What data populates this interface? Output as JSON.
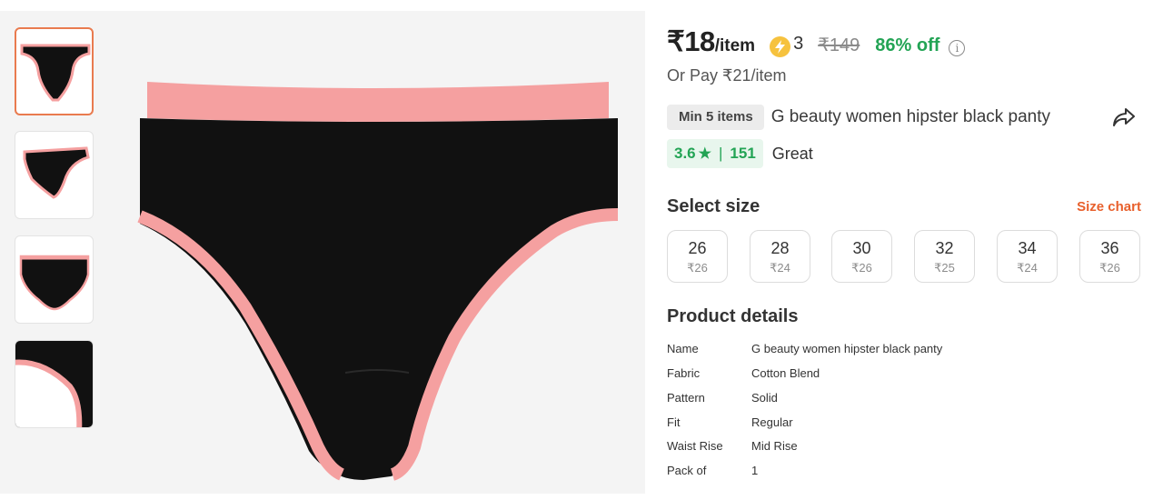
{
  "thumbnails": [
    {
      "name": "thumbnail-front",
      "active": true
    },
    {
      "name": "thumbnail-side",
      "active": false
    },
    {
      "name": "thumbnail-back",
      "active": false
    },
    {
      "name": "thumbnail-closeup",
      "active": false
    }
  ],
  "price": {
    "current": "₹18",
    "unit": "/item",
    "coins": "3",
    "mrp": "₹149",
    "discount": "86% off",
    "or_pay": "Or Pay ₹21/item"
  },
  "product": {
    "min_badge": "Min 5 items",
    "title": "G beauty women hipster black panty"
  },
  "rating": {
    "score": "3.6",
    "star": "★",
    "divider": "|",
    "count": "151",
    "label": "Great"
  },
  "size_section": {
    "title": "Select size",
    "chart_link": "Size chart",
    "sizes": [
      {
        "size": "26",
        "price": "₹26"
      },
      {
        "size": "28",
        "price": "₹24"
      },
      {
        "size": "30",
        "price": "₹26"
      },
      {
        "size": "32",
        "price": "₹25"
      },
      {
        "size": "34",
        "price": "₹24"
      },
      {
        "size": "36",
        "price": "₹26"
      }
    ]
  },
  "details": {
    "title": "Product details",
    "rows": [
      {
        "key": "Name",
        "value": "G beauty women hipster black panty"
      },
      {
        "key": "Fabric",
        "value": "Cotton Blend"
      },
      {
        "key": "Pattern",
        "value": "Solid"
      },
      {
        "key": "Fit",
        "value": "Regular"
      },
      {
        "key": "Waist Rise",
        "value": "Mid Rise"
      },
      {
        "key": "Pack of",
        "value": "1"
      }
    ]
  },
  "colors": {
    "garment": "#111111",
    "trim": "#f5a0a0",
    "discount": "#23a455",
    "accent": "#e8602c"
  },
  "icons": {
    "coin": "lightning-coin-icon",
    "info": "info-icon",
    "share": "share-icon",
    "star": "star-icon"
  }
}
